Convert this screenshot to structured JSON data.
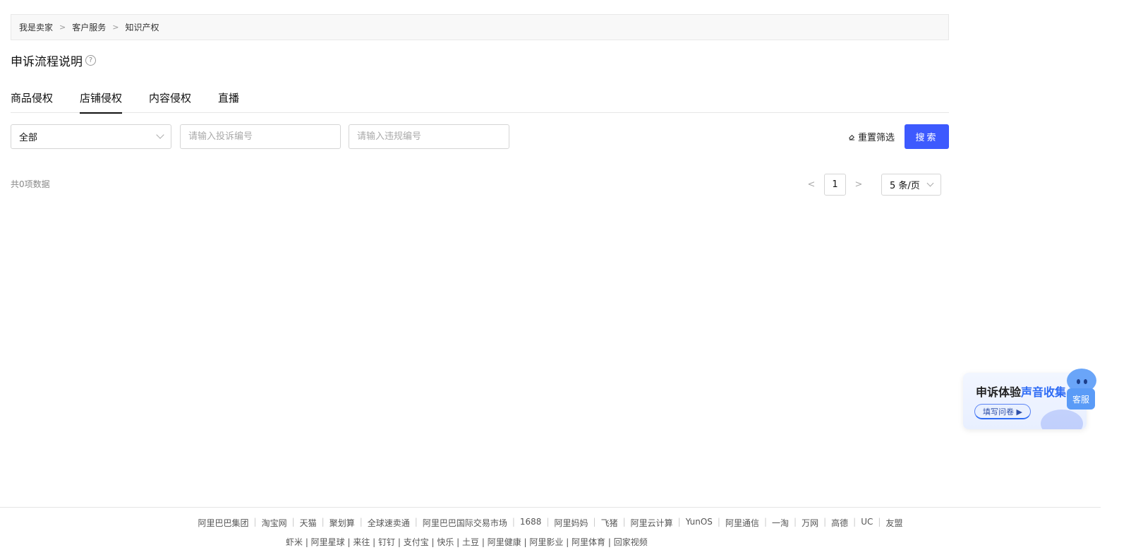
{
  "breadcrumb": {
    "items": [
      "我是卖家",
      "客户服务",
      "知识产权"
    ],
    "separator": ">"
  },
  "page_title": "申诉流程说明",
  "help_icon_glyph": "?",
  "tabs": [
    {
      "label": "商品侵权",
      "active": false
    },
    {
      "label": "店铺侵权",
      "active": true
    },
    {
      "label": "内容侵权",
      "active": false
    },
    {
      "label": "直播",
      "active": false
    }
  ],
  "filters": {
    "type_select_value": "全部",
    "complaint_placeholder": "请输入投诉编号",
    "violation_placeholder": "请输入违规编号",
    "reset_label": "重置筛选",
    "search_label": "搜索"
  },
  "results": {
    "total_text": "共0项数据"
  },
  "pagination": {
    "prev": "<",
    "current_page": "1",
    "next": ">",
    "page_size": "5 条/页"
  },
  "banner": {
    "title_prefix": "申诉体验",
    "title_highlight": "声音收集",
    "cta": "填写问卷 ▶"
  },
  "customer_service": {
    "label": "客服"
  },
  "footer": {
    "links": [
      "阿里巴巴集团",
      "淘宝网",
      "天猫",
      "聚划算",
      "全球速卖通",
      "阿里巴巴国际交易市场",
      "1688",
      "阿里妈妈",
      "飞猪",
      "阿里云计算",
      "YunOS",
      "阿里通信",
      "一淘",
      "万网",
      "高德",
      "UC",
      "友盟"
    ],
    "links_row2": "虾米 | 阿里星球 | 来往 | 钉钉 | 支付宝 | 快乐 | 土豆 | 阿里健康 | 阿里影业 | 阿里体育 | 回家视频"
  },
  "colors": {
    "primary": "#3d5afe",
    "banner_highlight": "#2e6cf5"
  }
}
